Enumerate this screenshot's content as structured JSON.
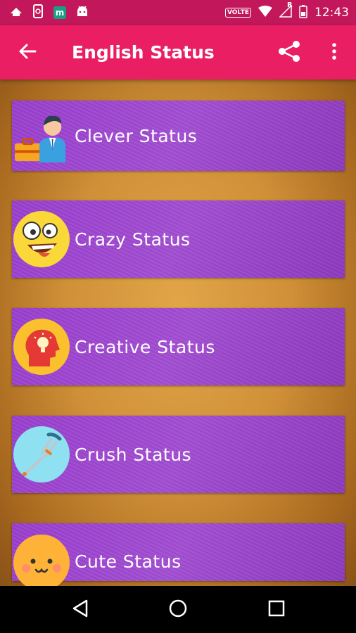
{
  "status_bar": {
    "time": "12:43",
    "volte": "VOLTE",
    "roaming": "R",
    "m_badge": "m"
  },
  "app_bar": {
    "title": "English Status"
  },
  "categories": [
    {
      "label": "Clever Status",
      "icon": "businessman-icon"
    },
    {
      "label": "Crazy Status",
      "icon": "crazy-face-icon"
    },
    {
      "label": "Creative Status",
      "icon": "creative-head-icon"
    },
    {
      "label": "Crush Status",
      "icon": "crutch-icon"
    },
    {
      "label": "Cute Status",
      "icon": "cute-face-icon"
    }
  ],
  "colors": {
    "status_bar": "#c2185b",
    "app_bar": "#e91e63",
    "card": "#9b3fd0",
    "background": "#cf9038"
  }
}
